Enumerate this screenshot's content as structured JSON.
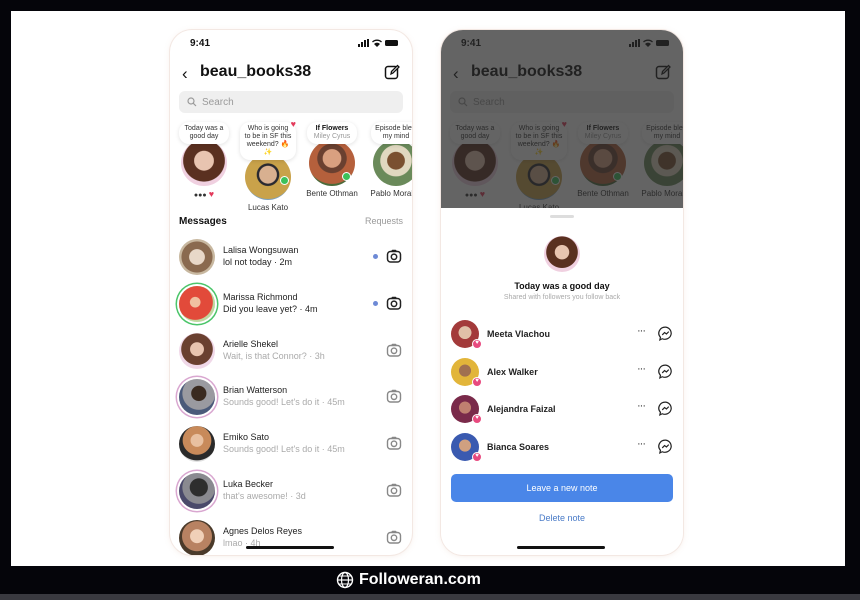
{
  "footer": {
    "brand": "Followeran.com",
    "icon": "globe-icon"
  },
  "phones": {
    "left": {
      "status": {
        "time": "9:41"
      },
      "header": {
        "title": "beau_books38",
        "back_icon": "chevron-left-icon",
        "compose_icon": "compose-icon"
      },
      "search": {
        "placeholder": "Search"
      },
      "notes": [
        {
          "text": "Today was a good day",
          "name": "",
          "has_heart": true,
          "online": false,
          "avatar_color": "#b46a5a"
        },
        {
          "text": "Who is going to be in SF this weekend? 🔥✨",
          "name": "Lucas Kato",
          "has_heart": true,
          "online": true,
          "avatar_color": "#c9a24a"
        },
        {
          "title": "If Flowers",
          "subtitle": "Miley Cyrus",
          "name": "Bente Othman",
          "online": true,
          "avatar_color": "#a5603c"
        },
        {
          "text": "Episode blew my mind",
          "name": "Pablo Morales",
          "online": false,
          "avatar_color": "#5f7a4a"
        }
      ],
      "messages_label": "Messages",
      "requests_label": "Requests",
      "messages": [
        {
          "name": "Lalisa Wongsuwan",
          "preview": "lol not today · 2m",
          "unread": true,
          "ring": "",
          "avatar_color": "#8a6a4f"
        },
        {
          "name": "Marissa Richmond",
          "preview": "Did you leave yet? · 4m",
          "unread": true,
          "ring": "green",
          "avatar_color": "#e24a3a"
        },
        {
          "name": "Arielle Shekel",
          "preview": "Wait, is that Connor? · 3h",
          "unread": false,
          "ring": "",
          "avatar_color": "#6a4030"
        },
        {
          "name": "Brian Watterson",
          "preview": "Sounds good! Let's do it · 45m",
          "unread": false,
          "ring": "story",
          "avatar_color": "#3a3a3a"
        },
        {
          "name": "Emiko Sato",
          "preview": "Sounds good! Let's do it · 45m",
          "unread": false,
          "ring": "",
          "avatar_color": "#c88a5a"
        },
        {
          "name": "Luka Becker",
          "preview": "that's awesome! · 3d",
          "unread": false,
          "ring": "story",
          "avatar_color": "#2e2e2e"
        },
        {
          "name": "Agnes Delos Reyes",
          "preview": "lmao · 4h",
          "unread": false,
          "ring": "",
          "avatar_color": "#b88262"
        }
      ]
    },
    "right": {
      "status": {
        "time": "9:41"
      },
      "header": {
        "title": "beau_books38"
      },
      "search": {
        "placeholder": "Search"
      },
      "notes": [
        {
          "text": "Today was a good day",
          "name": ""
        },
        {
          "text": "Who is going to be in SF this weekend? 🔥✨",
          "name": "Lucas Kato"
        },
        {
          "title": "If Flowers",
          "subtitle": "Miley Cyrus",
          "name": "Bente Othman"
        },
        {
          "text": "Episode blew my mind",
          "name": "Pablo Morales"
        }
      ],
      "sheet": {
        "note_title": "Today was a good day",
        "note_subtitle": "Shared with followers you follow back",
        "viewers": [
          {
            "name": "Meeta Vlachou",
            "avatar_color": "#a33a3a"
          },
          {
            "name": "Alex Walker",
            "avatar_color": "#e2b53a"
          },
          {
            "name": "Alejandra Faizal",
            "avatar_color": "#7a2a4a"
          },
          {
            "name": "Bianca Soares",
            "avatar_color": "#3a5ab0"
          }
        ],
        "more_label": "···",
        "primary_button": "Leave a new note",
        "delete_label": "Delete note",
        "accent_color": "#4a86e8"
      }
    }
  }
}
